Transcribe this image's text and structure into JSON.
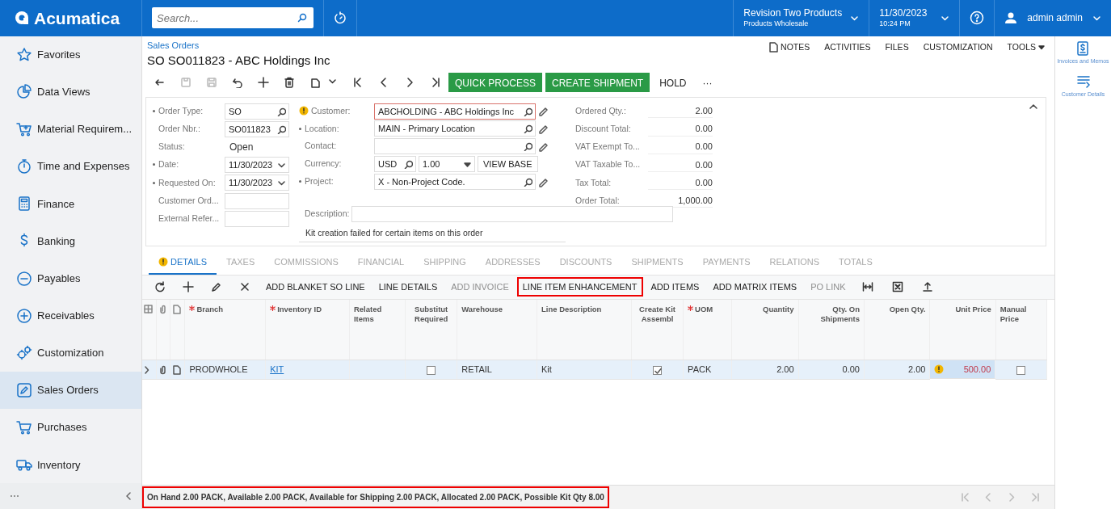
{
  "topbar": {
    "logo": "Acumatica",
    "search": {
      "placeholder": "Search..."
    },
    "company": {
      "name": "Revision Two Products",
      "branch": "Products Wholesale"
    },
    "datetime": {
      "date": "11/30/2023",
      "time": "10:24 PM"
    },
    "user": "admin admin"
  },
  "sidebar": {
    "items": [
      {
        "label": "Favorites",
        "selected": false
      },
      {
        "label": "Data Views",
        "selected": false
      },
      {
        "label": "Material Requirem...",
        "selected": false
      },
      {
        "label": "Time and Expenses",
        "selected": false
      },
      {
        "label": "Finance",
        "selected": false
      },
      {
        "label": "Banking",
        "selected": false
      },
      {
        "label": "Payables",
        "selected": false
      },
      {
        "label": "Receivables",
        "selected": false
      },
      {
        "label": "Customization",
        "selected": false
      },
      {
        "label": "Sales Orders",
        "selected": true
      },
      {
        "label": "Purchases",
        "selected": false
      },
      {
        "label": "Inventory",
        "selected": false
      }
    ]
  },
  "header": {
    "breadcrumb": "Sales Orders",
    "title": "SO SO011823 - ABC Holdings Inc",
    "links": [
      "NOTES",
      "ACTIVITIES",
      "FILES",
      "CUSTOMIZATION",
      "TOOLS"
    ],
    "actions": [
      {
        "label": "QUICK PROCESS",
        "kind": "primary"
      },
      {
        "label": "CREATE SHIPMENT",
        "kind": "primary"
      },
      {
        "label": "HOLD",
        "kind": "plain"
      },
      {
        "label": "···",
        "kind": "plain"
      }
    ]
  },
  "form": {
    "columns": [
      [
        {
          "label": "Order Type:",
          "required": true,
          "kind": "lookup",
          "value": "SO"
        },
        {
          "label": "Order Nbr.:",
          "required": false,
          "kind": "lookup",
          "value": "SO011823"
        },
        {
          "label": "Status:",
          "required": false,
          "kind": "static",
          "value": "Open"
        },
        {
          "label": "Date:",
          "required": true,
          "kind": "date",
          "value": "11/30/2023"
        },
        {
          "label": "Requested On:",
          "required": true,
          "kind": "date",
          "value": "11/30/2023"
        },
        {
          "label": "Customer Ord...",
          "required": false,
          "kind": "text"
        },
        {
          "label": "External Refer...",
          "required": false,
          "kind": "text"
        }
      ],
      [
        {
          "label": "Customer:",
          "required": false,
          "warning": true,
          "error": true,
          "kind": "lookup",
          "edit": true,
          "value": "ABCHOLDING - ABC Holdings Inc"
        },
        {
          "label": "Location:",
          "required": true,
          "kind": "lookup",
          "edit": true,
          "value": "MAIN - Primary Location"
        },
        {
          "label": "Contact:",
          "required": false,
          "kind": "lookup",
          "edit": true
        },
        {
          "label": "Currency:",
          "required": false,
          "kind": "currency",
          "value": "USD",
          "rate": "1.00",
          "button": "VIEW BASE"
        },
        {
          "label": "Project:",
          "required": true,
          "kind": "lookup",
          "edit": true,
          "value": "X - Non-Project Code."
        }
      ]
    ],
    "description": {
      "label": "Description:"
    },
    "message": "Kit creation failed for certain items on this order",
    "totals": [
      {
        "label": "Ordered Qty.:",
        "value": "2.00"
      },
      {
        "label": "Discount Total:",
        "value": "0.00"
      },
      {
        "label": "VAT Exempt To...",
        "value": "0.00"
      },
      {
        "label": "VAT Taxable To...",
        "value": "0.00"
      },
      {
        "label": "Tax Total:",
        "value": "0.00"
      },
      {
        "label": "Order Total:",
        "value": "1,000.00"
      }
    ]
  },
  "tabs": [
    {
      "label": "DETAILS",
      "selected": true,
      "warning": true
    },
    {
      "label": "TAXES",
      "selected": false
    },
    {
      "label": "COMMISSIONS",
      "selected": false
    },
    {
      "label": "FINANCIAL",
      "selected": false
    },
    {
      "label": "SHIPPING",
      "selected": false
    },
    {
      "label": "ADDRESSES",
      "selected": false
    },
    {
      "label": "DISCOUNTS",
      "selected": false
    },
    {
      "label": "SHIPMENTS",
      "selected": false
    },
    {
      "label": "PAYMENTS",
      "selected": false
    },
    {
      "label": "RELATIONS",
      "selected": false
    },
    {
      "label": "TOTALS",
      "selected": false
    }
  ],
  "grid_toolbar": [
    {
      "label": "ADD BLANKET SO LINE",
      "disabled": false
    },
    {
      "label": "LINE DETAILS",
      "disabled": false
    },
    {
      "label": "ADD INVOICE",
      "disabled": true
    },
    {
      "label": "LINE ITEM ENHANCEMENT",
      "disabled": false,
      "highlighted": true
    },
    {
      "label": "ADD ITEMS",
      "disabled": false
    },
    {
      "label": "ADD MATRIX ITEMS",
      "disabled": false
    },
    {
      "label": "PO LINK",
      "disabled": true
    }
  ],
  "table": {
    "columns": [
      {
        "label": "Branch",
        "required": true,
        "kind": "text"
      },
      {
        "label": "Inventory ID",
        "required": true,
        "kind": "link"
      },
      {
        "label": "Related Items",
        "required": false,
        "kind": "text"
      },
      {
        "label": "Substitut Required",
        "required": false,
        "kind": "checkbox"
      },
      {
        "label": "Warehouse",
        "required": false,
        "kind": "text"
      },
      {
        "label": "Line Description",
        "required": false,
        "kind": "text"
      },
      {
        "label": "Create Kit Assembl",
        "required": false,
        "kind": "checkbox"
      },
      {
        "label": "UOM",
        "required": true,
        "kind": "text"
      },
      {
        "label": "Quantity",
        "required": false,
        "kind": "number"
      },
      {
        "label": "Qty. On Shipments",
        "required": false,
        "kind": "number"
      },
      {
        "label": "Open Qty.",
        "required": false,
        "kind": "number"
      },
      {
        "label": "Unit Price",
        "required": false,
        "kind": "number"
      },
      {
        "label": "Manual Price",
        "required": false,
        "kind": "checkbox"
      }
    ],
    "rows": [
      {
        "selected": true,
        "cells": [
          {
            "value": "PRODWHOLE"
          },
          {
            "value": "KIT"
          },
          {},
          {
            "checked": false
          },
          {
            "value": "RETAIL"
          },
          {
            "value": "Kit"
          },
          {
            "checked": true
          },
          {
            "value": "PACK"
          },
          {
            "value": "2.00"
          },
          {
            "value": "0.00"
          },
          {
            "value": "2.00"
          },
          {
            "value": "500.00",
            "warning": true
          },
          {
            "checked": false
          }
        ]
      }
    ]
  },
  "status_bar": {
    "text": "On Hand 2.00 PACK, Available 2.00 PACK, Available for Shipping 2.00 PACK, Allocated 2.00 PACK, Possible Kit Qty 8.00",
    "highlighted": true
  },
  "right_panel": [
    {
      "label": "Invoices and Memos"
    },
    {
      "label": "Customer Details"
    }
  ]
}
